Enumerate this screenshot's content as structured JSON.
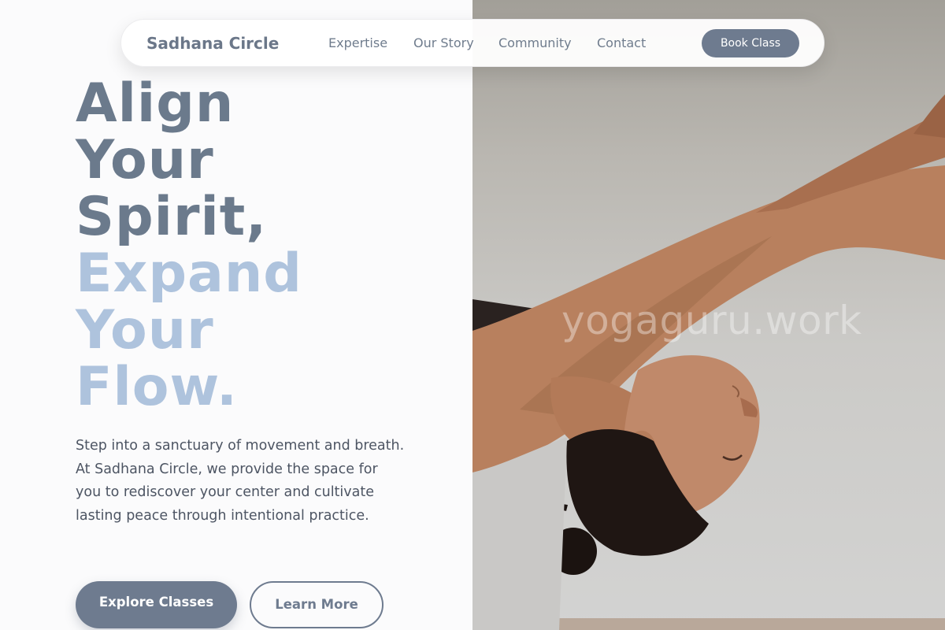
{
  "nav": {
    "brand": "Sadhana Circle",
    "links": [
      "Expertise",
      "Our Story",
      "Community",
      "Contact"
    ],
    "cta": "Book Class"
  },
  "hero": {
    "title_dark": [
      "Align",
      "Your",
      "Spirit,"
    ],
    "title_light": [
      "Expand",
      "Your",
      "Flow."
    ],
    "description": "Step into a sanctuary of movement and breath. At Sadhana Circle, we provide the space for you to rediscover your center and cultivate lasting peace through intentional practice.",
    "primary_button": "Explore Classes",
    "secondary_button": "Learn More"
  },
  "image": {
    "watermark": "yogaguru.work",
    "subject": "woman-yoga-inverted-pose-photo"
  },
  "colors": {
    "accent": "#6e7b8f",
    "heading_dark": "#6b7a8c",
    "heading_light": "#aec3dd"
  }
}
